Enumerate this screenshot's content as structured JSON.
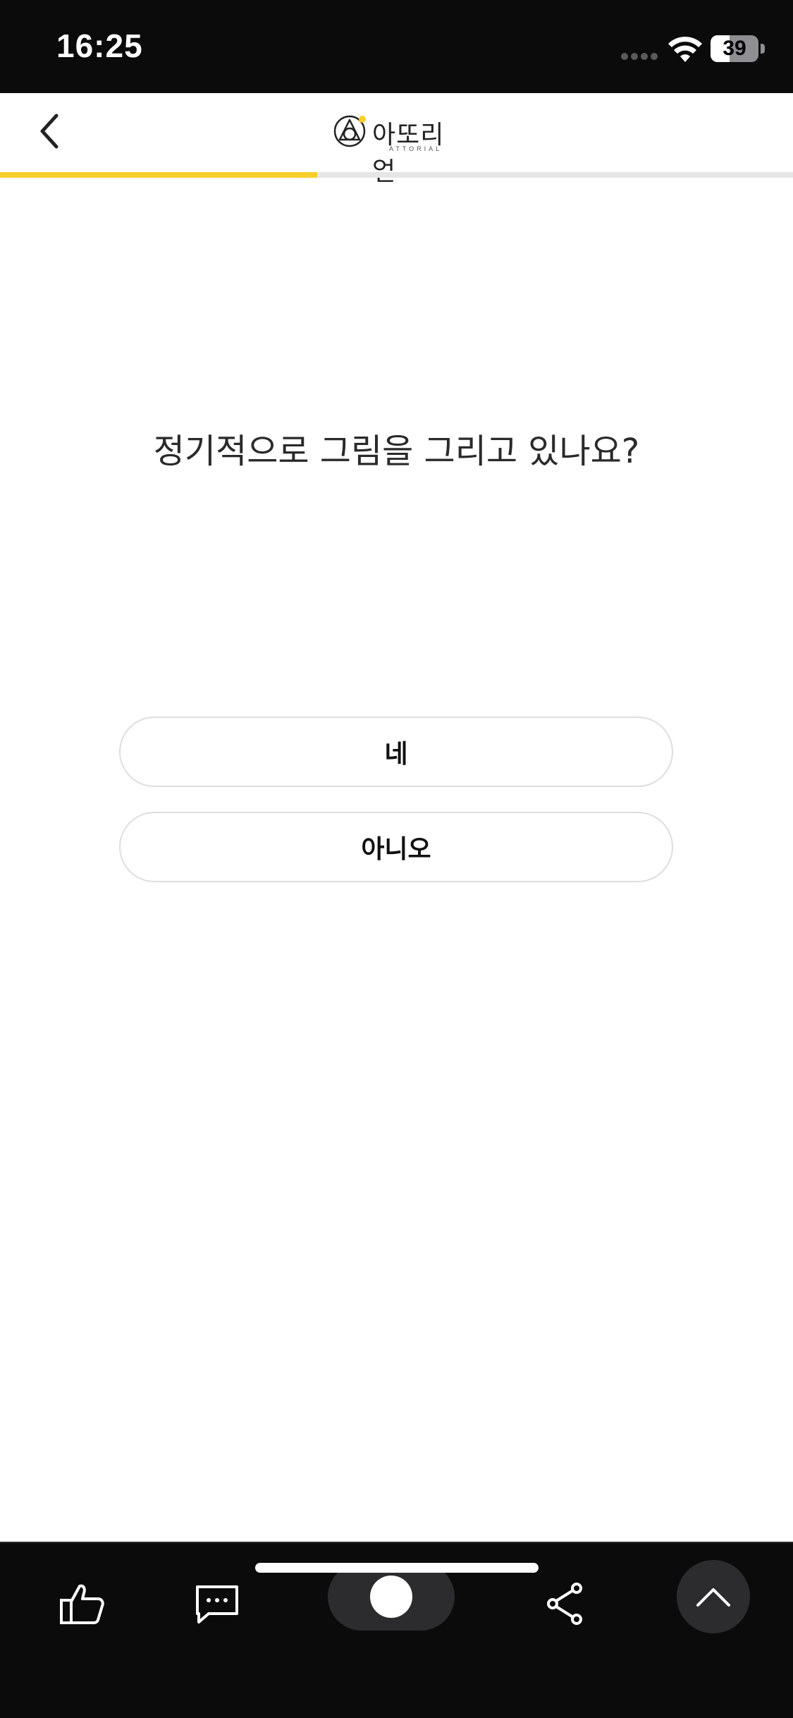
{
  "status_bar": {
    "time": "16:25",
    "battery_level": "39",
    "battery_fraction": 0.39
  },
  "header": {
    "logo_text": "아또리얼",
    "logo_subtext": "ATTORIAL",
    "progress_fraction": 0.4
  },
  "question": {
    "text": "정기적으로 그림을 그리고 있나요?"
  },
  "answers": [
    {
      "label": "네"
    },
    {
      "label": "아니오"
    }
  ],
  "toolbar": {
    "items": [
      "like-icon",
      "comment-icon",
      "toggle",
      "share-icon",
      "scroll-top-icon"
    ]
  },
  "colors": {
    "accent": "#f7cf2a",
    "background": "#ffffff",
    "chrome": "#0b0b0c"
  }
}
